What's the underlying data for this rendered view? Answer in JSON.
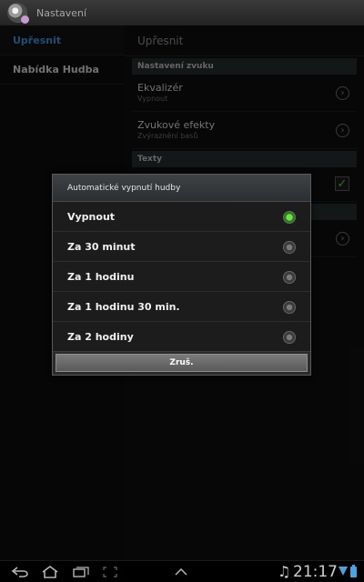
{
  "titlebar": {
    "title": "Nastavení"
  },
  "left": {
    "items": [
      {
        "label": "Upřesnit"
      },
      {
        "label": "Nabídka Hudba"
      }
    ]
  },
  "right": {
    "header": "Upřesnit",
    "section_sound": "Nastavení zvuku",
    "equalizer": {
      "title": "Ekvalizér",
      "subtitle": "Vypnout"
    },
    "effects": {
      "title": "Zvukové efekty",
      "subtitle": "Zvýraznění basů"
    },
    "section_text": "Texty"
  },
  "dialog": {
    "title": "Automatické vypnutí hudby",
    "options": [
      {
        "label": "Vypnout",
        "selected": true
      },
      {
        "label": "Za 30 minut",
        "selected": false
      },
      {
        "label": "Za 1 hodinu",
        "selected": false
      },
      {
        "label": "Za 1 hodinu 30 min.",
        "selected": false
      },
      {
        "label": "Za 2 hodiny",
        "selected": false
      }
    ],
    "cancel_label": "Zruš."
  },
  "statusbar": {
    "time": "21:17",
    "icons": [
      "back-icon",
      "home-icon",
      "recent-apps-icon",
      "screenshot-icon",
      "menu-up-icon",
      "music-note-icon",
      "signal-icon",
      "battery-icon"
    ]
  },
  "colors": {
    "accent": "#3a8fd6",
    "radio_on": "#6fe04a"
  }
}
